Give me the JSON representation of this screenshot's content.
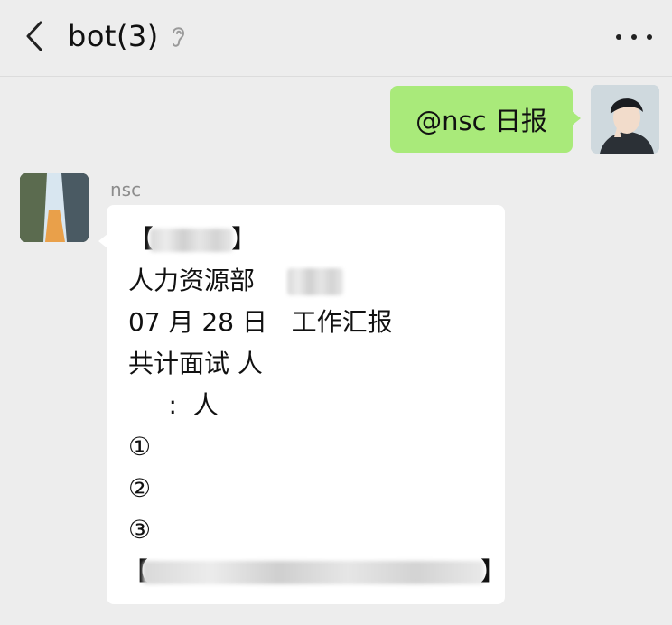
{
  "header": {
    "title": "bot(3)",
    "icons": {
      "back": "chevron-left-icon",
      "ear": "ear-icon",
      "more": "more-dots-icon"
    }
  },
  "messages": {
    "outgoing": {
      "text": "@nsc  日报"
    },
    "incoming": {
      "sender": "nsc",
      "lines": [
        "【",
        "人力资源部",
        "07 月 28 日   工作汇报",
        "共计面试 人",
        "     :  人",
        "①",
        "②",
        "③",
        "【"
      ]
    }
  },
  "colors": {
    "outgoing_bubble": "#a9ea7a",
    "incoming_bubble": "#ffffff",
    "background": "#ededed"
  }
}
